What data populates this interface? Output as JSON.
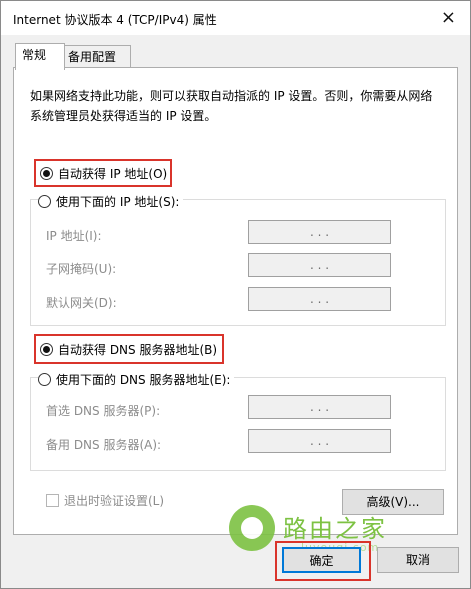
{
  "window": {
    "title": "Internet 协议版本 4 (TCP/IPv4) 属性",
    "close_glyph": "×"
  },
  "tabs": [
    {
      "label": "常规"
    },
    {
      "label": "备用配置"
    }
  ],
  "description": "如果网络支持此功能，则可以获取自动指派的 IP 设置。否则，你需要从网络系统管理员处获得适当的 IP 设置。",
  "ip": {
    "auto_label": "自动获得 IP 地址(O)",
    "manual_label": "使用下面的 IP 地址(S):",
    "fields": [
      {
        "label": "IP 地址(I):",
        "value": ".   .   ."
      },
      {
        "label": "子网掩码(U):",
        "value": ".   .   ."
      },
      {
        "label": "默认网关(D):",
        "value": ".   .   ."
      }
    ]
  },
  "dns": {
    "auto_label": "自动获得 DNS 服务器地址(B)",
    "manual_label": "使用下面的 DNS 服务器地址(E):",
    "fields": [
      {
        "label": "首选 DNS 服务器(P):",
        "value": ".   .   ."
      },
      {
        "label": "备用 DNS 服务器(A):",
        "value": ".   .   ."
      }
    ]
  },
  "validate_label": "退出时验证设置(L)",
  "advanced_label": "高级(V)...",
  "ok_label": "确定",
  "cancel_label": "取消",
  "watermark": {
    "text": "路由之家",
    "url": "luyouqi.com"
  },
  "colors": {
    "highlight_red": "#d9342b",
    "ok_blue": "#0078d7",
    "watermark_green": "#7dc243"
  }
}
